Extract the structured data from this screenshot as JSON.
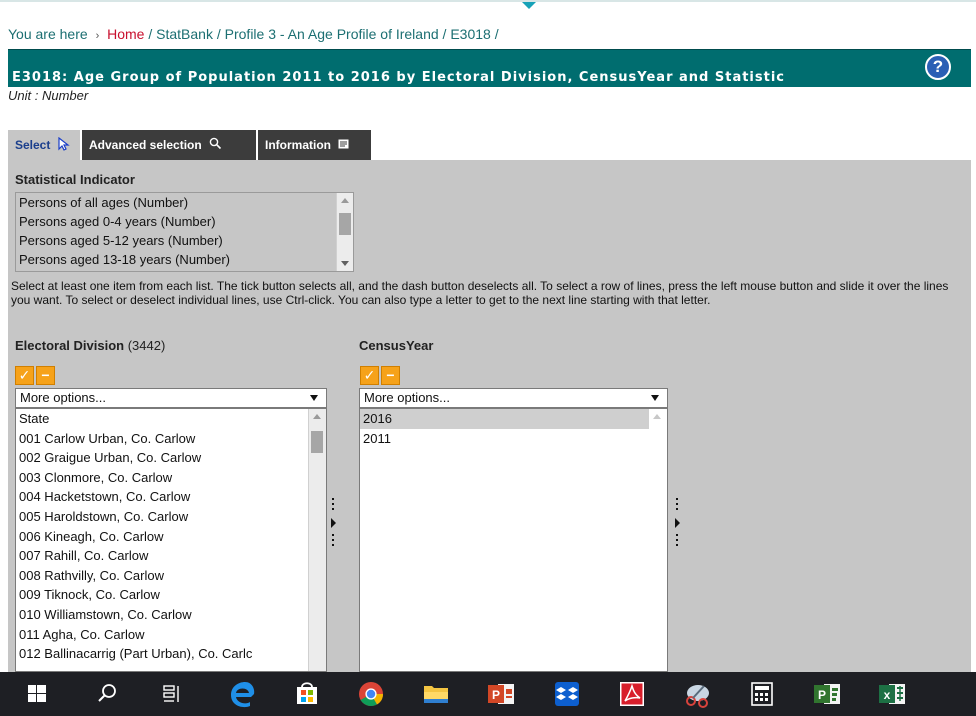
{
  "breadcrumb": {
    "prefix": "You are here",
    "separator": "›",
    "home": "Home",
    "path": "/ StatBank / Profile 3 - An Age Profile of Ireland / E3018 /"
  },
  "header": {
    "title": "E3018: Age Group of Population 2011 to 2016 by Electoral Division, CensusYear and Statistic",
    "help_icon": "?",
    "unit": "Unit : Number"
  },
  "tabs": [
    {
      "label": "Select",
      "icon": "cursor-icon",
      "active": true
    },
    {
      "label": "Advanced selection",
      "icon": "magnifier-icon",
      "active": false
    },
    {
      "label": "Information",
      "icon": "document-icon",
      "active": false
    }
  ],
  "statistical_indicator": {
    "label": "Statistical Indicator",
    "items": [
      "Persons of all ages (Number)",
      "Persons aged 0-4 years (Number)",
      "Persons aged 5-12 years (Number)",
      "Persons aged 13-18 years (Number)"
    ]
  },
  "instructions": "Select at least one item from each list. The tick button selects all, and the dash button deselects all. To select a row of lines, press the left mouse button and slide it over the lines you want. To select or deselect individual lines, use Ctrl-click. You can also type a letter to get to the next line starting with that letter.",
  "electoral_division": {
    "label": "Electoral Division",
    "count": "(3442)",
    "select_all": "✓",
    "deselect_all": "−",
    "dropdown": "More options...",
    "items": [
      "State",
      "001 Carlow Urban, Co. Carlow",
      "002 Graigue Urban, Co. Carlow",
      "003 Clonmore, Co. Carlow",
      "004 Hacketstown, Co. Carlow",
      "005 Haroldstown, Co. Carlow",
      "006 Kineagh, Co. Carlow",
      "007 Rahill, Co. Carlow",
      "008 Rathvilly, Co. Carlow",
      "009 Tiknock, Co. Carlow",
      "010 Williamstown, Co. Carlow",
      "011 Agha, Co. Carlow",
      "012 Ballinacarrig (Part Urban), Co. Carlc"
    ]
  },
  "census_year": {
    "label": "CensusYear",
    "select_all": "✓",
    "deselect_all": "−",
    "dropdown": "More options...",
    "items": [
      "2016",
      "2011"
    ],
    "selected": "2016"
  },
  "taskbar": [
    "windows-start-icon",
    "search-icon",
    "task-view-icon",
    "edge-browser-icon",
    "store-icon",
    "chrome-icon",
    "file-explorer-icon",
    "powerpoint-icon",
    "dropbox-icon",
    "acrobat-icon",
    "snipping-tool-icon",
    "calculator-icon",
    "project-icon",
    "excel-icon"
  ]
}
